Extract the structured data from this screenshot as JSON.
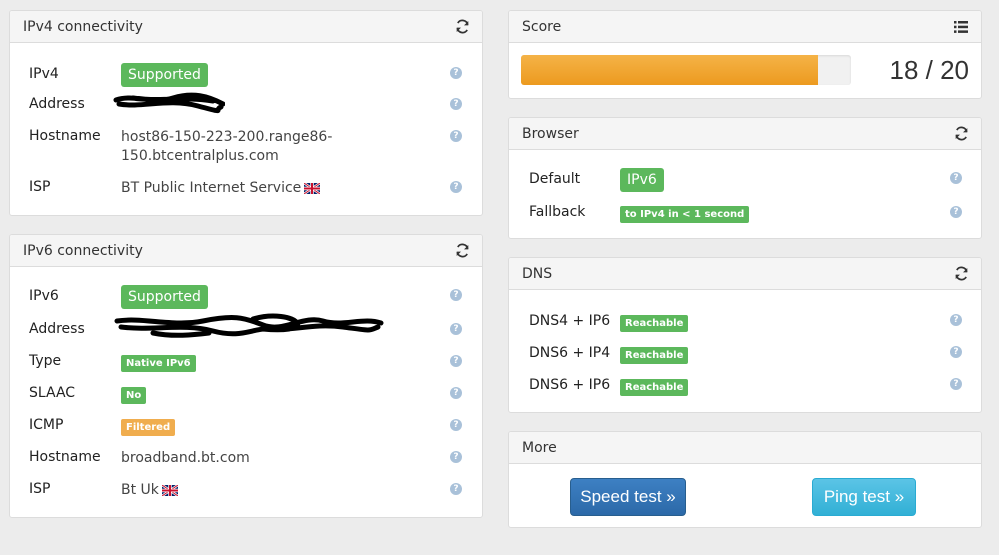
{
  "ipv4": {
    "title": "IPv4 connectivity",
    "rows": {
      "ipv4": {
        "label": "IPv4",
        "badge": "Supported"
      },
      "address": {
        "label": "Address"
      },
      "hostname": {
        "label": "Hostname",
        "value_line1": "host86-150-223-200.range86-",
        "value_line2": "150.btcentralplus.com"
      },
      "isp": {
        "label": "ISP",
        "value": "BT Public Internet Service"
      }
    }
  },
  "ipv6": {
    "title": "IPv6 connectivity",
    "rows": {
      "ipv6": {
        "label": "IPv6",
        "badge": "Supported"
      },
      "address": {
        "label": "Address"
      },
      "type": {
        "label": "Type",
        "badge": "Native IPv6"
      },
      "slaac": {
        "label": "SLAAC",
        "badge": "No"
      },
      "icmp": {
        "label": "ICMP",
        "badge": "Filtered"
      },
      "hostname": {
        "label": "Hostname",
        "value": "broadband.bt.com"
      },
      "isp": {
        "label": "ISP",
        "value": "Bt Uk"
      }
    }
  },
  "score": {
    "title": "Score",
    "value": 18,
    "max": 20,
    "text": "18 / 20"
  },
  "browser": {
    "title": "Browser",
    "rows": {
      "default": {
        "label": "Default",
        "badge": "IPv6"
      },
      "fallback": {
        "label": "Fallback",
        "badge": "to IPv4 in < 1 second"
      }
    }
  },
  "dns": {
    "title": "DNS",
    "rows": {
      "dns4_ip6": {
        "label": "DNS4 + IP6",
        "badge": "Reachable"
      },
      "dns6_ip4": {
        "label": "DNS6 + IP4",
        "badge": "Reachable"
      },
      "dns6_ip6": {
        "label": "DNS6 + IP6",
        "badge": "Reachable"
      }
    }
  },
  "more": {
    "title": "More",
    "speed_test": "Speed test »",
    "ping_test": "Ping test »"
  },
  "help_glyph": "?",
  "colors": {
    "success": "#5cb85c",
    "warning": "#f0ad4e",
    "progress": "#ec9a1f",
    "primary": "#2c69a8",
    "info": "#31b0d5"
  },
  "icons": {
    "refresh": "refresh-icon",
    "list": "list-icon",
    "help": "help-icon",
    "flag": "uk-flag-icon"
  }
}
